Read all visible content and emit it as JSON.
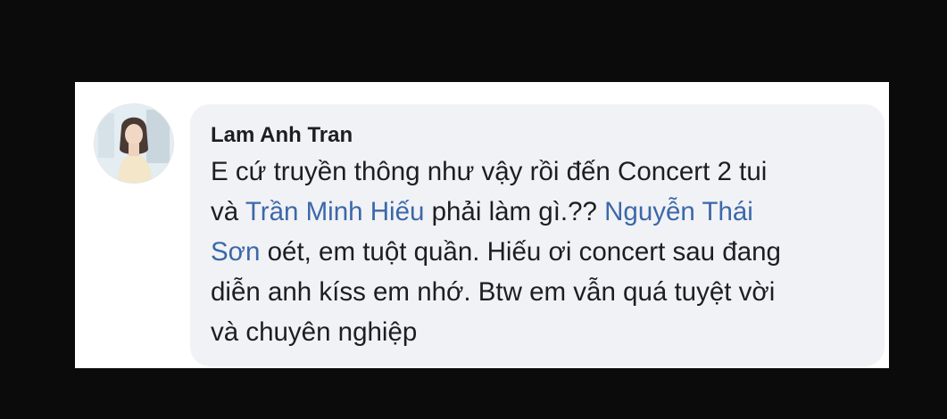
{
  "comment": {
    "author": "Lam Anh Tran",
    "lines": [
      {
        "segments": [
          {
            "text": "E cứ truyền thông như vậy rồi đến Concert 2 tui"
          }
        ]
      },
      {
        "segments": [
          {
            "text": "và "
          },
          {
            "text": "Trần Minh Hiếu",
            "mention": true
          },
          {
            "text": " phải làm gì.?? "
          },
          {
            "text": "Nguyễn Thái",
            "mention": true
          }
        ]
      },
      {
        "segments": [
          {
            "text": "Sơn",
            "mention": true
          },
          {
            "text": " oét, em tuột quần. Hiếu ơi concert sau đang"
          }
        ]
      },
      {
        "segments": [
          {
            "text": "diễn anh kíss em nhớ. Btw em vẫn quá tuyệt vời"
          }
        ]
      },
      {
        "segments": [
          {
            "text": "và chuyên nghiệp"
          }
        ]
      }
    ]
  },
  "colors": {
    "mention": "#3b68a8",
    "text": "#1c1e21",
    "bubble": "#f1f2f5",
    "background": "#0b0b0b"
  },
  "icons": {
    "avatar": "profile-photo"
  }
}
